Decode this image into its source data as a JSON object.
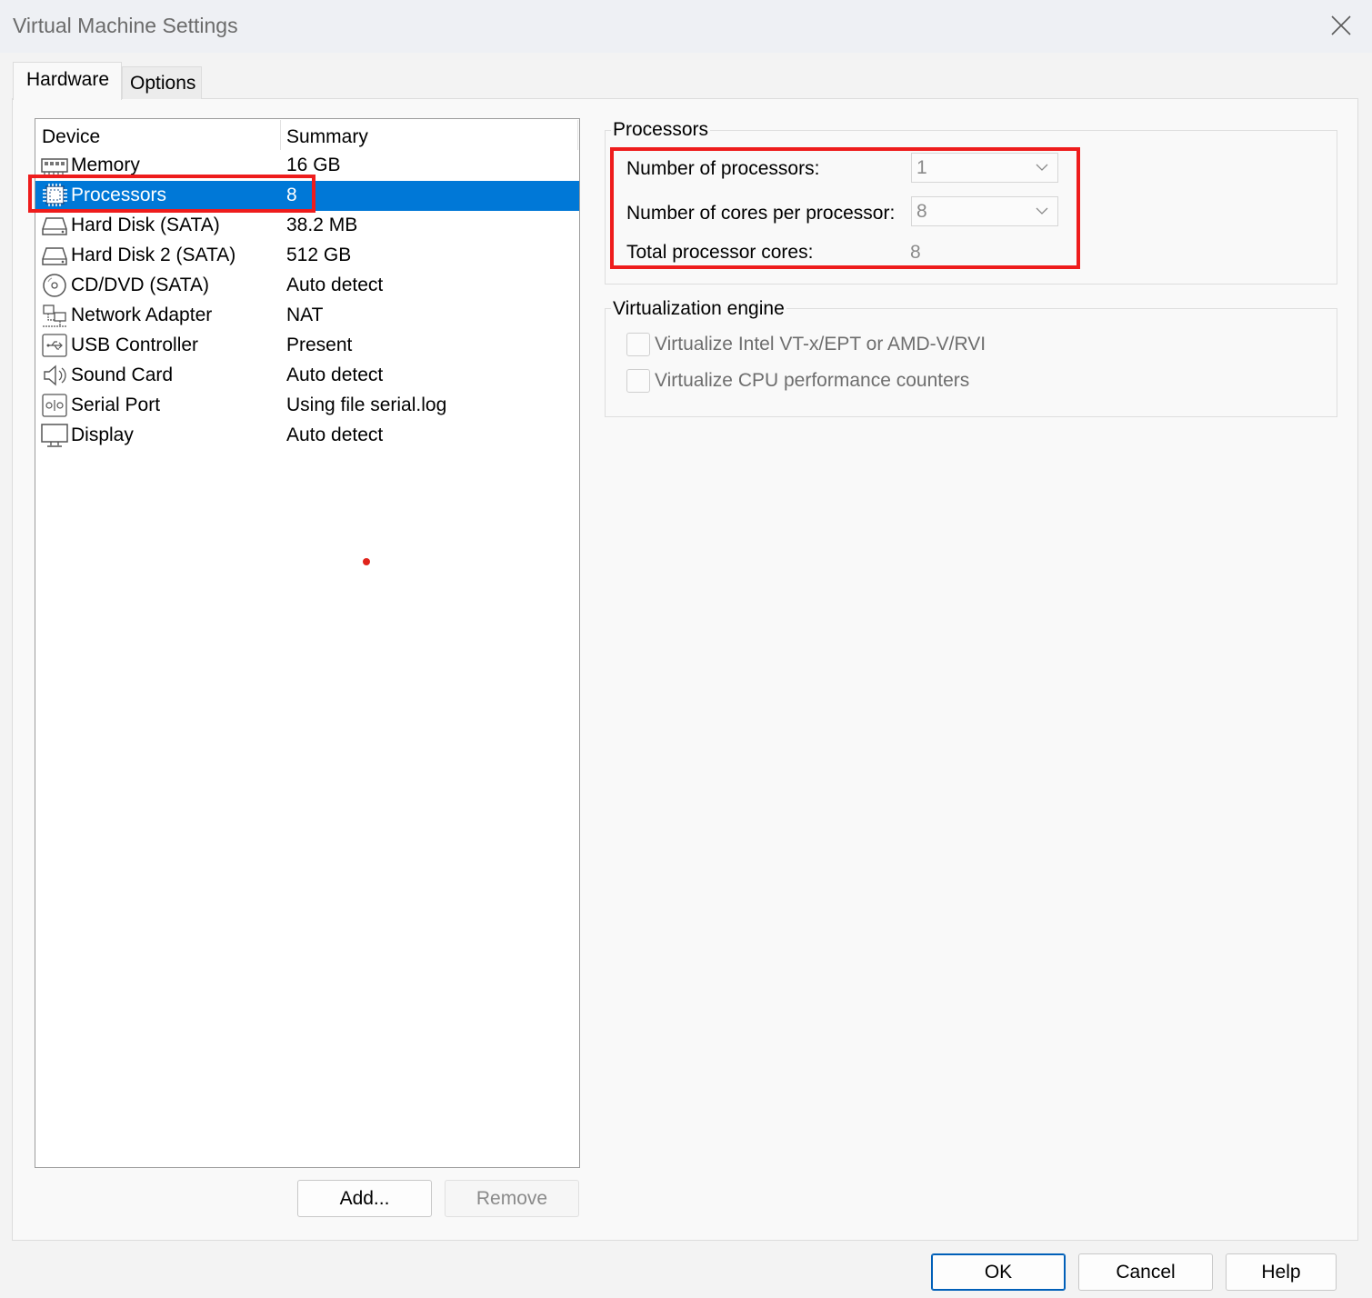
{
  "window": {
    "title": "Virtual Machine Settings",
    "close_icon": "close-icon"
  },
  "tabs": [
    {
      "label": "Hardware",
      "active": true
    },
    {
      "label": "Options",
      "active": false
    }
  ],
  "device_list": {
    "columns": {
      "device": "Device",
      "summary": "Summary"
    },
    "rows": [
      {
        "name": "Memory",
        "summary": "16 GB",
        "icon": "memory-icon",
        "selected": false
      },
      {
        "name": "Processors",
        "summary": "8",
        "icon": "processor-icon",
        "selected": true
      },
      {
        "name": "Hard Disk (SATA)",
        "summary": "38.2 MB",
        "icon": "hard-disk-icon",
        "selected": false
      },
      {
        "name": "Hard Disk 2 (SATA)",
        "summary": "512 GB",
        "icon": "hard-disk-icon",
        "selected": false
      },
      {
        "name": "CD/DVD (SATA)",
        "summary": "Auto detect",
        "icon": "cd-dvd-icon",
        "selected": false
      },
      {
        "name": "Network Adapter",
        "summary": "NAT",
        "icon": "network-adapter-icon",
        "selected": false
      },
      {
        "name": "USB Controller",
        "summary": "Present",
        "icon": "usb-icon",
        "selected": false
      },
      {
        "name": "Sound Card",
        "summary": "Auto detect",
        "icon": "speaker-icon",
        "selected": false
      },
      {
        "name": "Serial Port",
        "summary": "Using file serial.log",
        "icon": "serial-port-icon",
        "selected": false
      },
      {
        "name": "Display",
        "summary": "Auto detect",
        "icon": "monitor-icon",
        "selected": false
      }
    ],
    "add_button": "Add...",
    "remove_button": "Remove"
  },
  "processors_group": {
    "label": "Processors",
    "num_processors_label": "Number of processors:",
    "num_processors_value": "1",
    "cores_per_processor_label": "Number of cores per processor:",
    "cores_per_processor_value": "8",
    "total_cores_label": "Total processor cores:",
    "total_cores_value": "8"
  },
  "virtualization_group": {
    "label": "Virtualization engine",
    "options": [
      {
        "label": "Virtualize Intel VT-x/EPT or AMD-V/RVI",
        "checked": false
      },
      {
        "label": "Virtualize CPU performance counters",
        "checked": false
      }
    ]
  },
  "footer": {
    "ok": "OK",
    "cancel": "Cancel",
    "help": "Help"
  },
  "colors": {
    "selection": "#0078d7",
    "highlight_box": "#ee1c1c",
    "primary_border": "#005fb8"
  }
}
